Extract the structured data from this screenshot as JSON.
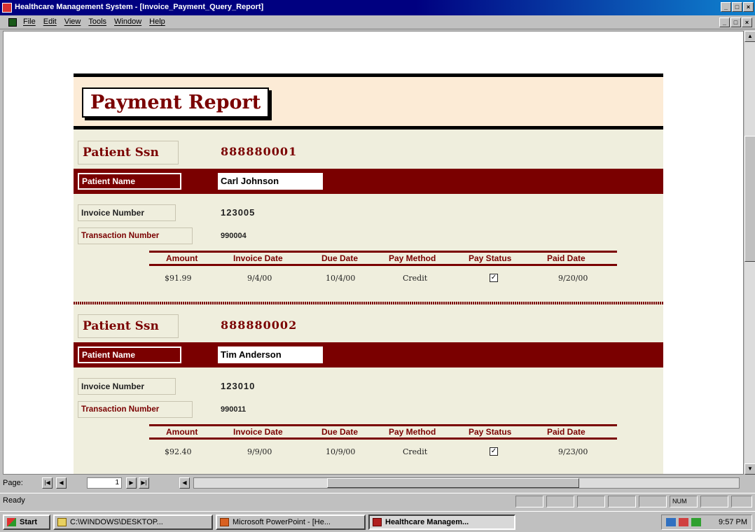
{
  "window": {
    "title": "Healthcare Management System - [Invoice_Payment_Query_Report]",
    "controls": [
      "_",
      "□",
      "×"
    ]
  },
  "menubar": {
    "items": [
      "File",
      "Edit",
      "View",
      "Tools",
      "Window",
      "Help"
    ],
    "mdi_controls": [
      "_",
      "□",
      "×"
    ]
  },
  "report": {
    "title": "Payment Report",
    "labels": {
      "patient_ssn": "Patient Ssn",
      "patient_name": "Patient Name",
      "invoice_number": "Invoice Number",
      "transaction_number": "Transaction Number"
    },
    "columns": [
      "Amount",
      "Invoice Date",
      "Due Date",
      "Pay Method",
      "Pay Status",
      "Paid Date"
    ],
    "records": [
      {
        "ssn": "888880001",
        "name": "Carl Johnson",
        "invoice_number": "123005",
        "transaction_number": "990004",
        "amount": "$91.99",
        "invoice_date": "9/4/00",
        "due_date": "10/4/00",
        "pay_method": "Credit",
        "pay_status_check": "✓",
        "paid_date": "9/20/00"
      },
      {
        "ssn": "888880002",
        "name": "Tim Anderson",
        "invoice_number": "123010",
        "transaction_number": "990011",
        "amount": "$92.40",
        "invoice_date": "9/9/00",
        "due_date": "10/9/00",
        "pay_method": "Credit",
        "pay_status_check": "✓",
        "paid_date": "9/23/00"
      }
    ]
  },
  "navigation": {
    "page_label": "Page:",
    "page_number": "1",
    "buttons": [
      "|◀",
      "◀",
      "▶",
      "▶|",
      "◀"
    ]
  },
  "status": {
    "text": "Ready",
    "num": "NUM"
  },
  "taskbar": {
    "start": "Start",
    "tasks": [
      "C:\\WINDOWS\\DESKTOP...",
      "Microsoft PowerPoint - [He...",
      "Healthcare Managem..."
    ],
    "clock": "9:57 PM"
  },
  "colors": {
    "accent": "#7a0000",
    "report_bg": "#efeedd",
    "header_bg": "#fcebd6",
    "titlebar": "#000080"
  }
}
